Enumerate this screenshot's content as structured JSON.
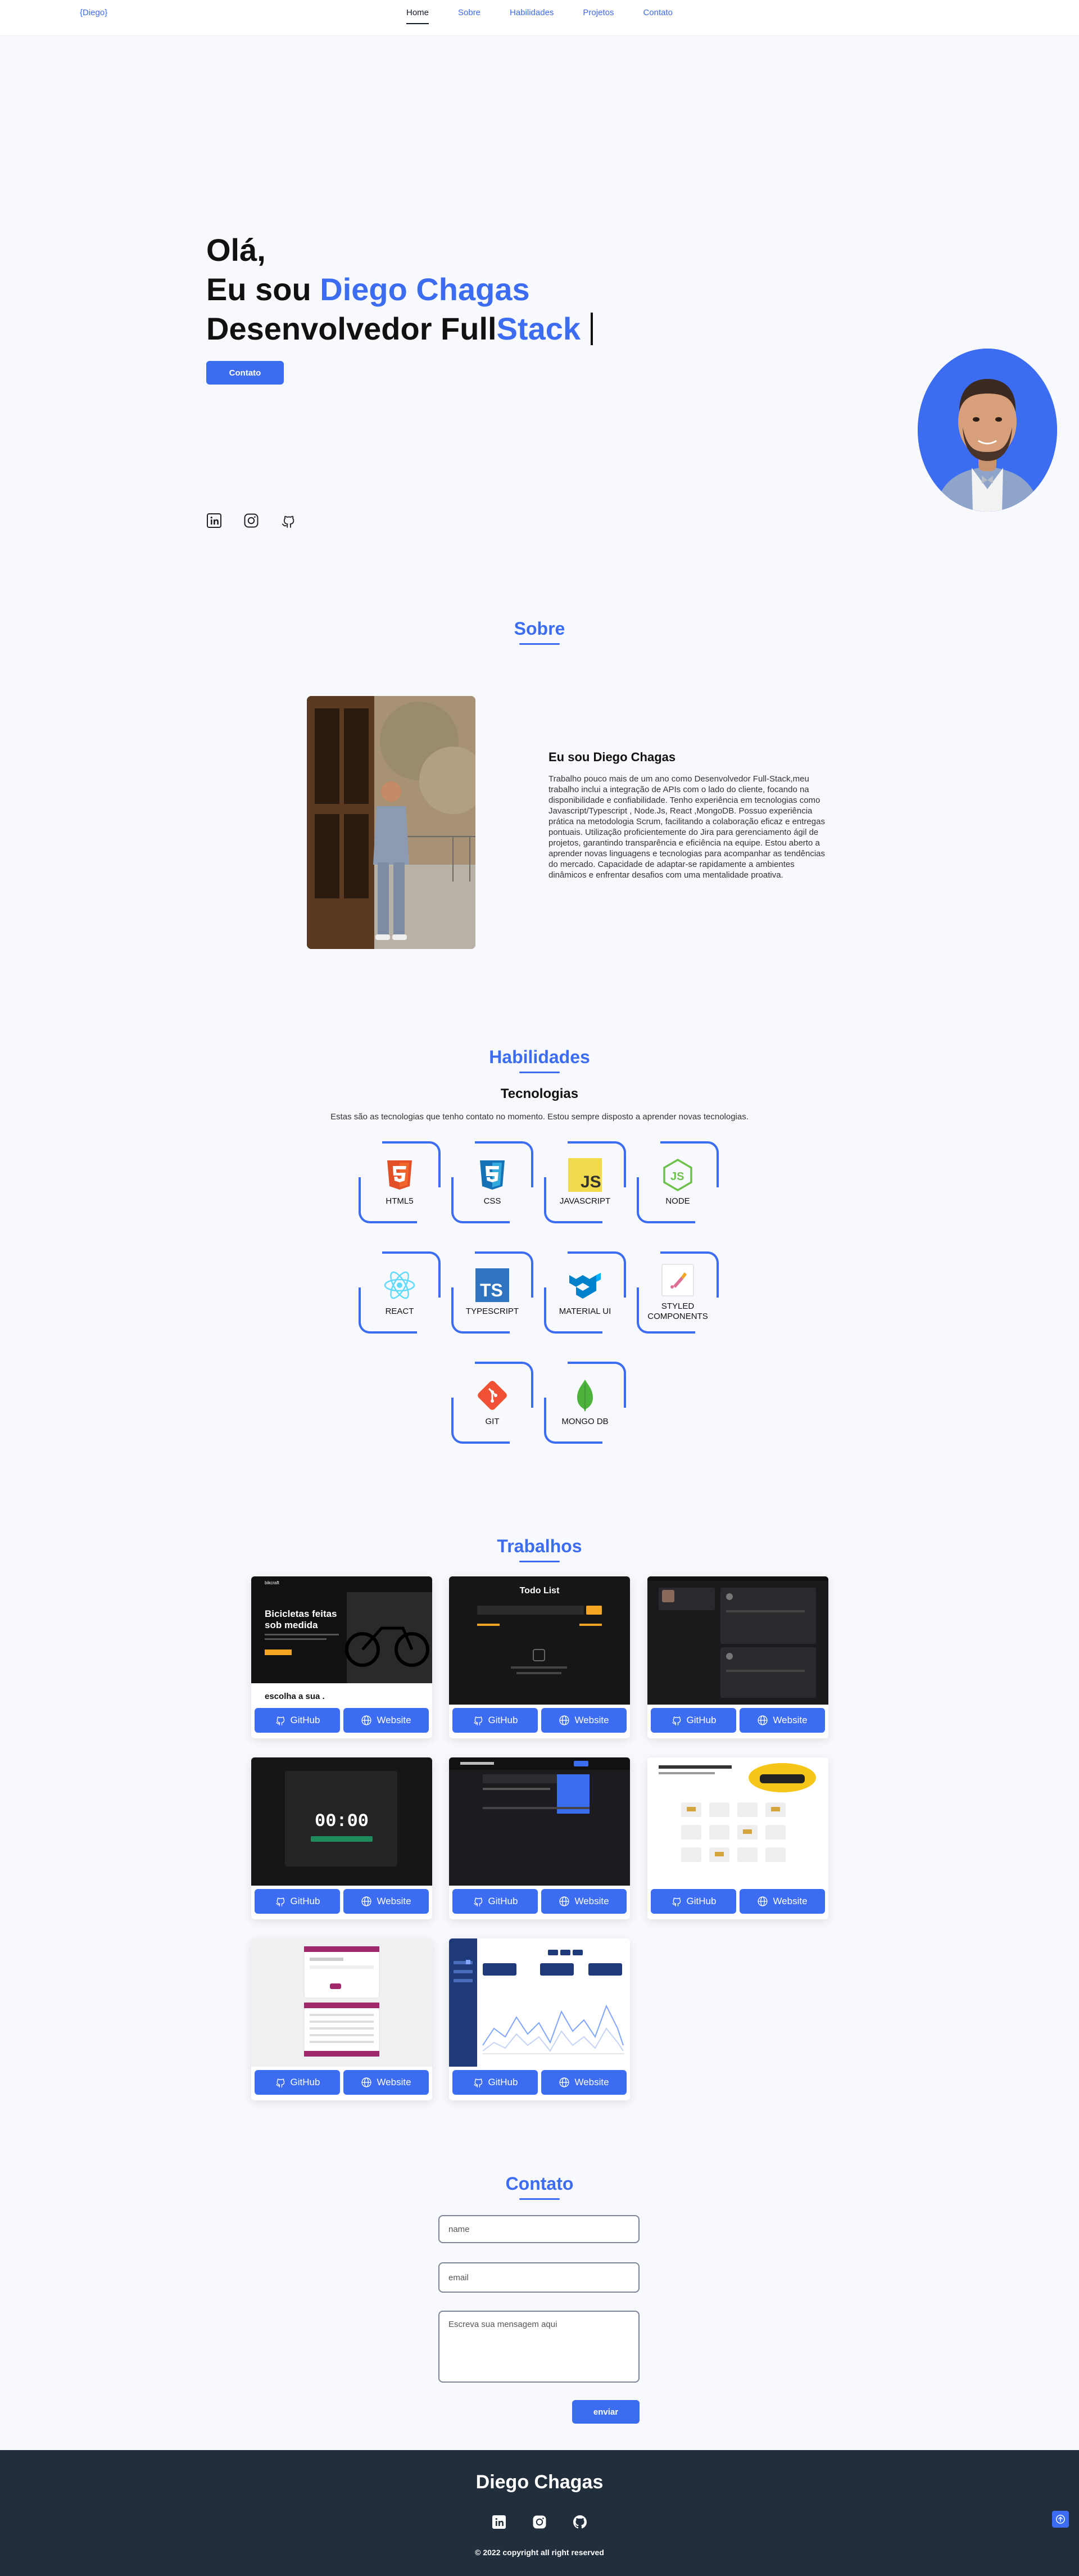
{
  "nav": {
    "logo": "{Diego}",
    "links": [
      "Home",
      "Sobre",
      "Habilidades",
      "Projetos",
      "Contato"
    ],
    "active": "Home"
  },
  "hero": {
    "line1": "Olá,",
    "line2_prefix": "Eu sou",
    "line2_name": "Diego Chagas",
    "line3_dark": "Desenvolvedor Full",
    "line3_blue": "Stack",
    "button": "Contato",
    "social_icons": [
      "linkedin-icon",
      "instagram-icon",
      "github-icon"
    ]
  },
  "sobre": {
    "title": "Sobre",
    "heading": "Eu sou Diego Chagas",
    "text": "Trabalho pouco mais de um ano como Desenvolvedor Full-Stack,meu trabalho inclui a integração de APIs com o lado do cliente, focando na disponibilidade e confiabilidade. Tenho experiência em tecnologias como Javascript/Typescript , Node.Js, React ,MongoDB. Possuo experiência prática na metodologia Scrum, facilitando a colaboração eficaz e entregas pontuais. Utilização proficientemente do Jira para gerenciamento ágil de projetos, garantindo transparência e eficiência na equipe. Estou aberto a aprender novas linguagens e tecnologias para acompanhar as tendências do mercado. Capacidade de adaptar-se rapidamente a ambientes dinâmicos e enfrentar desafios com uma mentalidade proativa."
  },
  "habilidades": {
    "title": "Habilidades",
    "subtitle": "Tecnologias",
    "description": "Estas são as tecnologias que tenho contato no momento. Estou sempre disposto a aprender novas tecnologias.",
    "skills": [
      {
        "label": "HTML5",
        "icon": "html5-icon",
        "color": "#e34f26"
      },
      {
        "label": "CSS",
        "icon": "css3-icon",
        "color": "#1572b6"
      },
      {
        "label": "JAVASCRIPT",
        "icon": "javascript-icon",
        "color": "#f0db4f"
      },
      {
        "label": "NODE",
        "icon": "nodejs-icon",
        "color": "#6cc24a"
      },
      {
        "label": "REACT",
        "icon": "react-icon",
        "color": "#61dafb"
      },
      {
        "label": "TYPESCRIPT",
        "icon": "typescript-icon",
        "color": "#2f74c0"
      },
      {
        "label": "MATERIAL UI",
        "icon": "material-ui-icon",
        "color": "#0081cb"
      },
      {
        "label": "STYLED COMPONENTS",
        "icon": "styled-components-icon",
        "color": "#db7093"
      },
      {
        "label": "GIT",
        "icon": "git-icon",
        "color": "#f05033"
      },
      {
        "label": "MONGO DB",
        "icon": "mongodb-icon",
        "color": "#4db33d"
      }
    ]
  },
  "trabalhos": {
    "title": "Trabalhos",
    "github_label": "GitHub",
    "website_label": "Website",
    "projects": [
      {
        "theme": "dark",
        "shot_title": "Bicicletas feitas sob medida",
        "shot_brand": "bikcraft",
        "shot_caption": "escolha a sua ."
      },
      {
        "theme": "dark",
        "shot_title": "Todo List"
      },
      {
        "theme": "dark"
      },
      {
        "theme": "dark",
        "shot_title": "00:00"
      },
      {
        "theme": "dark"
      },
      {
        "theme": "light"
      },
      {
        "theme": "light"
      },
      {
        "theme": "light"
      }
    ]
  },
  "contato": {
    "title": "Contato",
    "name_placeholder": "name",
    "email_placeholder": "email",
    "message_placeholder": "Escreva sua mensagem aqui",
    "send": "enviar"
  },
  "footer": {
    "name": "Diego Chagas",
    "copyright": "© 2022 copyright all right reserved"
  },
  "colors": {
    "accent": "#3b6cf2",
    "footer_bg": "#222e3b",
    "page_bg": "#f8f9fc"
  }
}
